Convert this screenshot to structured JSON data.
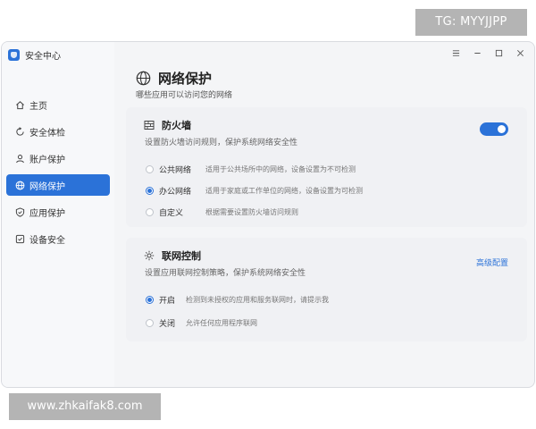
{
  "watermarks": {
    "top": "TG: MYYJJPP",
    "bottom": "www.zhkaifak8.com"
  },
  "app": {
    "title": "安全中心",
    "logo_icon": "shield-logo-icon"
  },
  "sidebar": {
    "items": [
      {
        "label": "主页",
        "icon": "home-icon",
        "active": false
      },
      {
        "label": "安全体检",
        "icon": "refresh-scan-icon",
        "active": false
      },
      {
        "label": "账户保护",
        "icon": "user-icon",
        "active": false
      },
      {
        "label": "网络保护",
        "icon": "globe-icon",
        "active": true
      },
      {
        "label": "应用保护",
        "icon": "shield-app-icon",
        "active": false
      },
      {
        "label": "设备安全",
        "icon": "device-check-icon",
        "active": false
      }
    ]
  },
  "window_controls": [
    "menu-icon",
    "minimize-icon",
    "maximize-icon",
    "close-icon"
  ],
  "header": {
    "title": "网络保护",
    "subtitle": "哪些应用可以访问您的网络",
    "icon": "globe-icon"
  },
  "firewall": {
    "title": "防火墙",
    "description": "设置防火墙访问规则，保护系统网络安全性",
    "enabled": true,
    "options": [
      {
        "label": "公共网络",
        "desc": "适用于公共场所中的网络，设备设置为不可检测",
        "checked": false
      },
      {
        "label": "办公网络",
        "desc": "适用于家庭或工作单位的网络，设备设置为可检测",
        "checked": true
      },
      {
        "label": "自定义",
        "desc": "根据需要设置防火墙访问规则",
        "checked": false
      }
    ]
  },
  "network_control": {
    "title": "联网控制",
    "description": "设置应用联网控制策略，保护系统网络安全性",
    "advanced_link": "高级配置",
    "options": [
      {
        "label": "开启",
        "desc": "检测到未授权的应用和服务联网时，请提示我",
        "checked": true
      },
      {
        "label": "关闭",
        "desc": "允许任何应用程序联网",
        "checked": false
      }
    ]
  },
  "colors": {
    "accent": "#2b72d8",
    "sidebar_bg": "#f7f8fa",
    "card_bg": "#f0f1f4"
  }
}
